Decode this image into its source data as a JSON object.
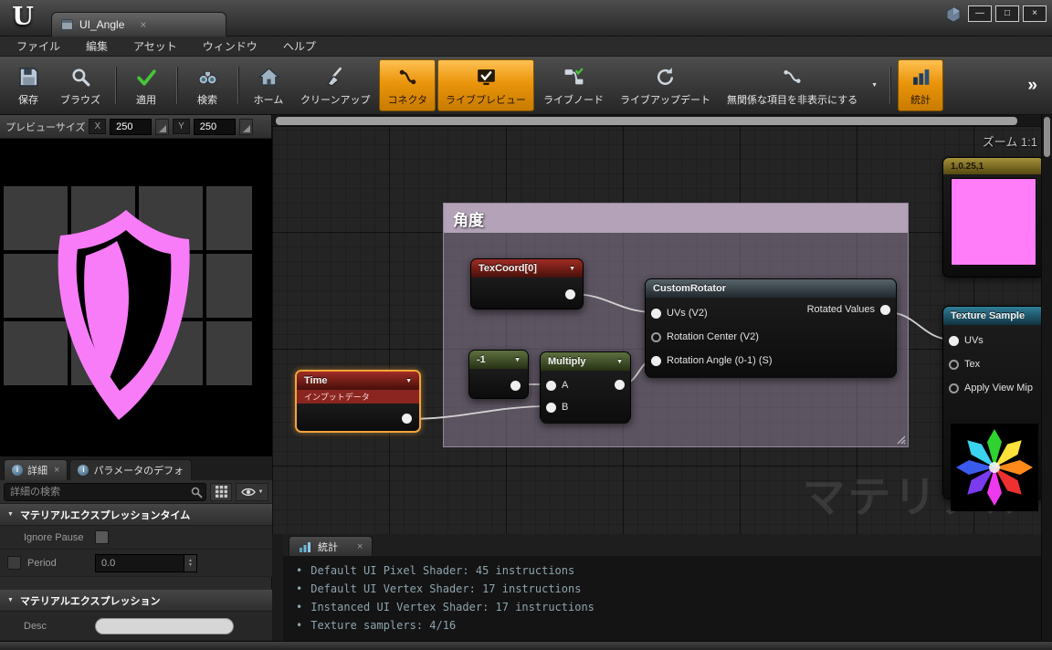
{
  "window": {
    "logo_text": "U",
    "tab_title": "UI_Angle",
    "controls": {
      "minimize": "—",
      "maximize": "□",
      "close": "×"
    }
  },
  "icons": {
    "close": "×",
    "collapse_arrow": "▼",
    "caret_down": "▼",
    "chevron_right": "»",
    "section_arrow": "▼",
    "bullet": "•",
    "info": "i"
  },
  "menubar": {
    "items": [
      "ファイル",
      "編集",
      "アセット",
      "ウィンドウ",
      "ヘルプ"
    ]
  },
  "toolbar": {
    "buttons": [
      {
        "label": "保存"
      },
      {
        "label": "ブラウズ"
      },
      {
        "label": "適用"
      },
      {
        "label": "検索"
      },
      {
        "label": "ホーム"
      },
      {
        "label": "クリーンアップ"
      },
      {
        "label": "コネクタ",
        "active": true
      },
      {
        "label": "ライブプレビュー",
        "active": true
      },
      {
        "label": "ライブノード"
      },
      {
        "label": "ライブアップデート"
      },
      {
        "label": "無関係な項目を非表示にする"
      },
      {
        "label": "統計",
        "active": true
      }
    ],
    "overflow_chevron": "»"
  },
  "preview": {
    "size_label": "プレビューサイズ",
    "x_label": "X",
    "x_value": "250",
    "y_label": "Y",
    "y_value": "250"
  },
  "details": {
    "tabs": [
      {
        "label": "詳細"
      },
      {
        "label": "パラメータのデフォ"
      }
    ],
    "search_placeholder": "詳細の検索",
    "sections": [
      {
        "title": "マテリアルエクスプレッションタイム",
        "rows": [
          {
            "label": "Ignore Pause"
          },
          {
            "label": "Period",
            "value": "0.0"
          }
        ]
      },
      {
        "title": "マテリアルエクスプレッション",
        "rows": [
          {
            "label": "Desc",
            "value": ""
          }
        ]
      }
    ]
  },
  "graph": {
    "zoom_label": "ズーム 1:1",
    "watermark": "マテリアル",
    "comment_title": "角度",
    "nodes": {
      "texcoord": {
        "title": "TexCoord[0]"
      },
      "custom_rotator": {
        "title": "CustomRotator",
        "inputs": [
          "UVs (V2)",
          "Rotation Center (V2)",
          "Rotation Angle (0-1) (S)"
        ],
        "outputs": [
          "Rotated Values"
        ]
      },
      "minus_one": {
        "title": "-1"
      },
      "multiply": {
        "title": "Multiply",
        "inputs": [
          "A",
          "B"
        ]
      },
      "time": {
        "title": "Time",
        "subtitle": "インプットデータ"
      },
      "constant": {
        "title": "1,0.25,1",
        "swatch_color": "#ff7df8"
      },
      "texture_sample": {
        "title": "Texture Sample",
        "inputs": [
          "UVs",
          "Tex",
          "Apply View Mip"
        ]
      }
    }
  },
  "stats": {
    "tab_label": "統計",
    "lines": [
      "Default UI Pixel Shader: 45 instructions",
      "Default UI Vertex Shader: 17 instructions",
      "Instanced UI Vertex Shader: 17 instructions",
      "Texture samplers: 4/16"
    ]
  },
  "colors": {
    "accent_orange": "#f0940e",
    "selection_orange": "#f2a43a",
    "comment_header": "#b3a2b8",
    "preview_pink": "#f87cf8",
    "swatch_pink": "#ff7df8",
    "wire_gray": "#d2d2d2",
    "stats_text": "#8ea4af"
  }
}
